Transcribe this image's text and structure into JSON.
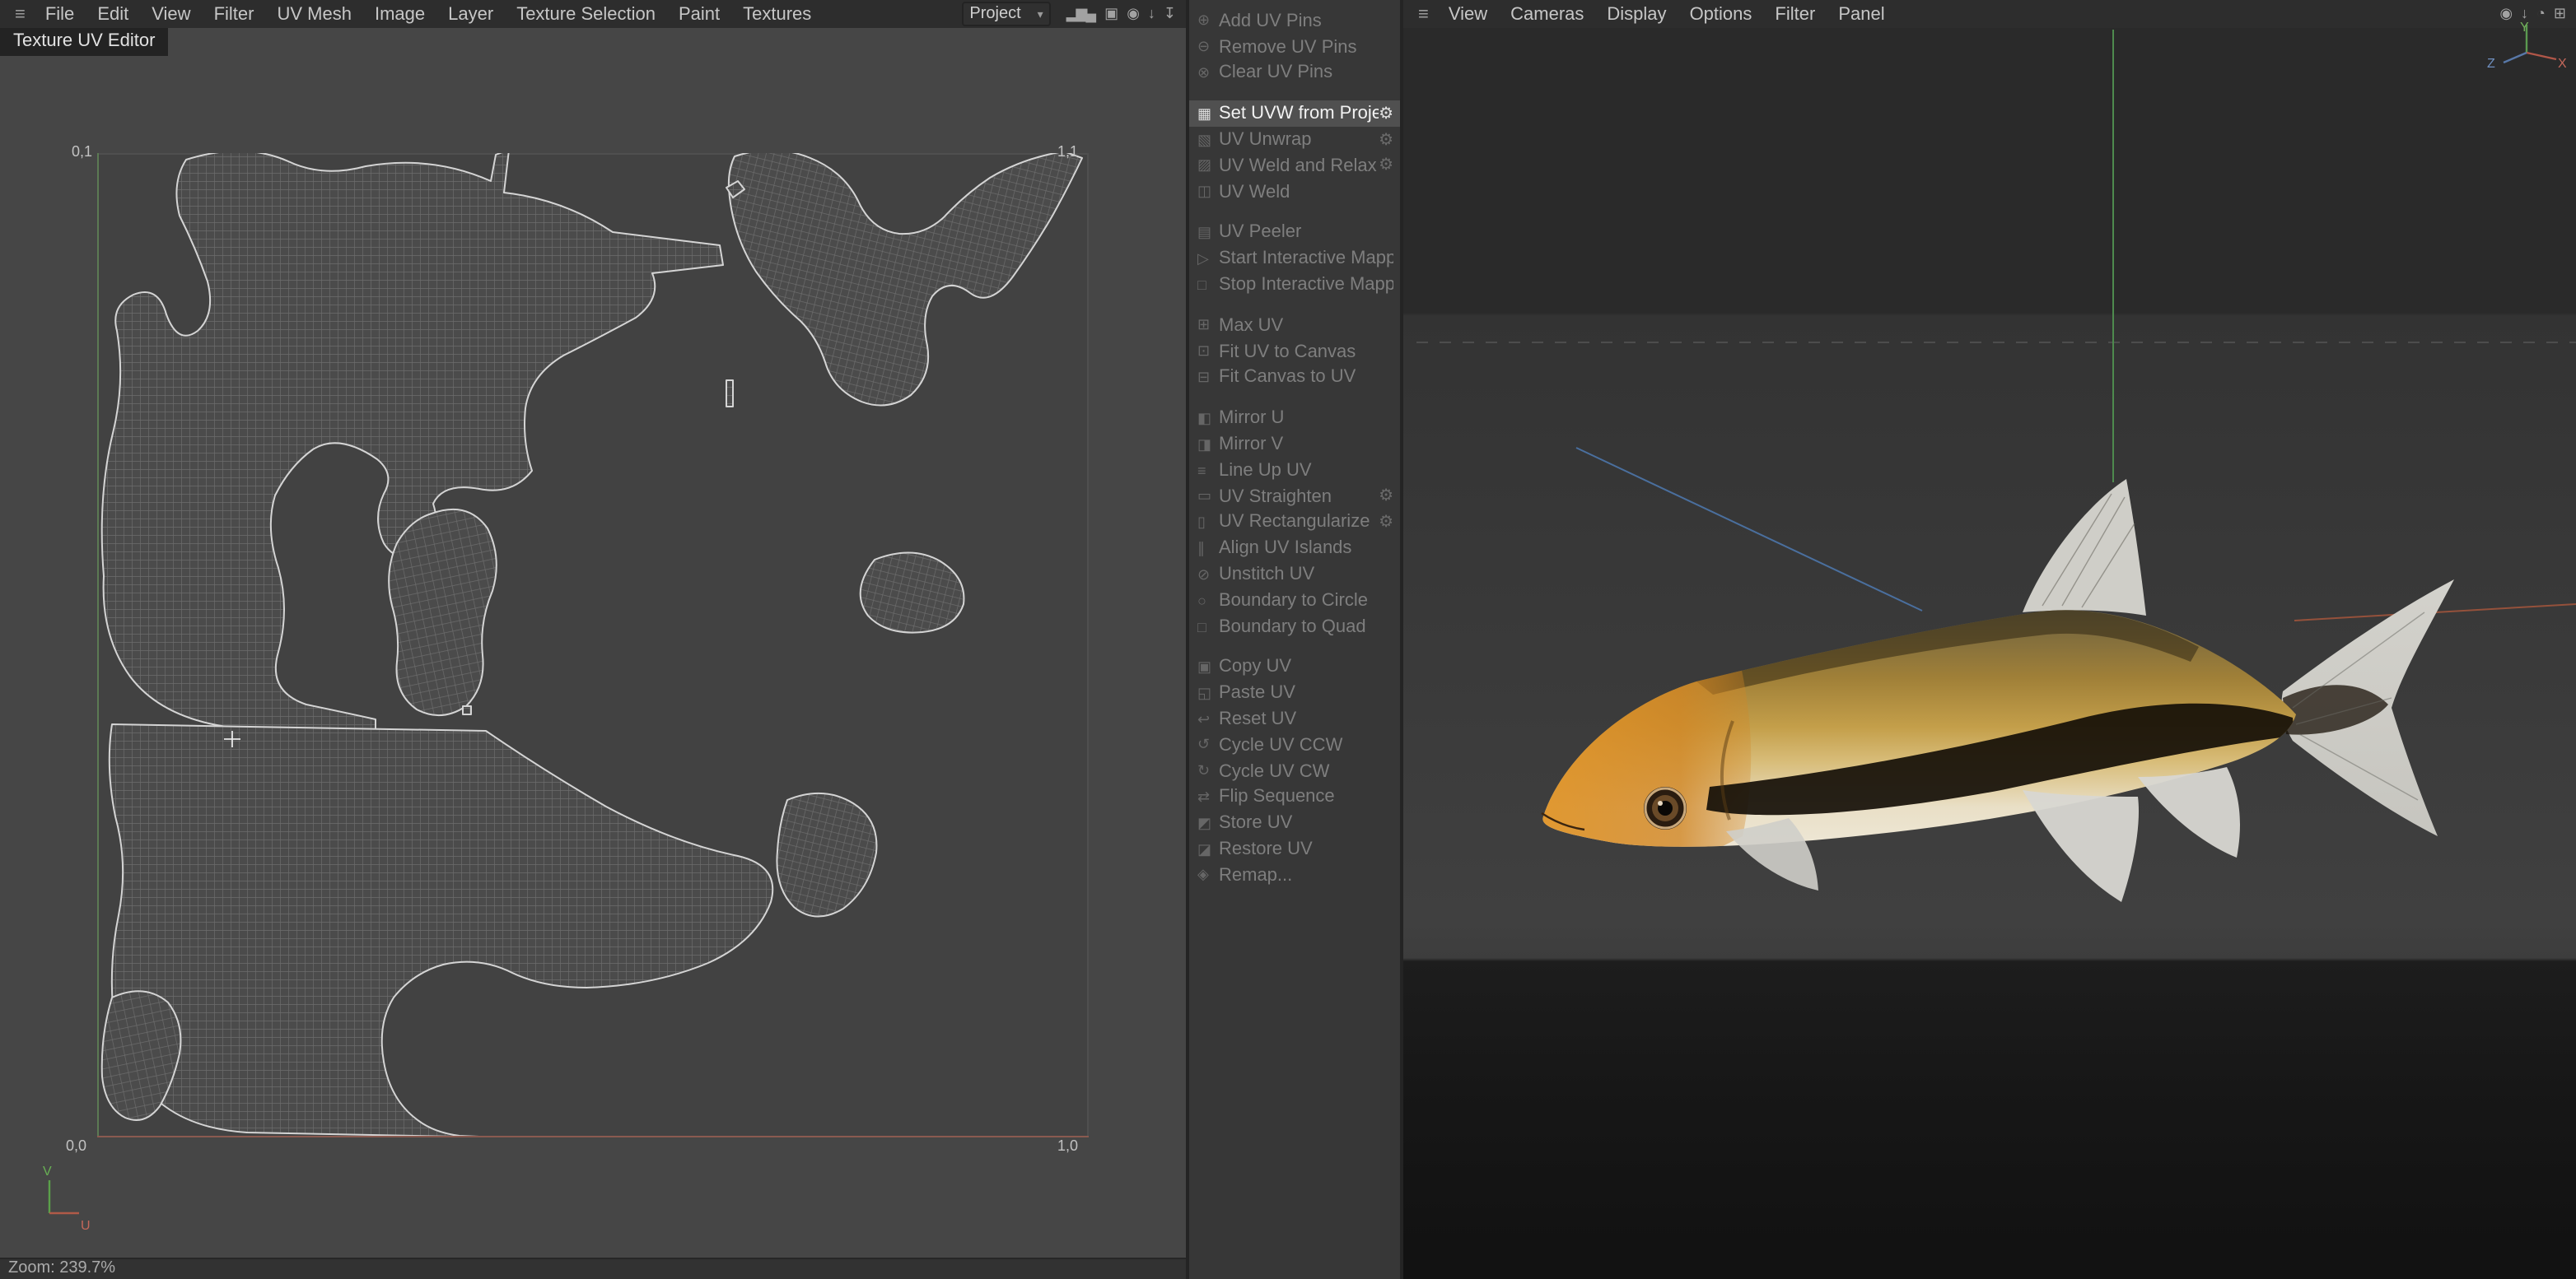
{
  "uv_pane": {
    "menubar": {
      "hamburger_glyph": "≡",
      "items": [
        "File",
        "Edit",
        "View",
        "Filter",
        "UV Mesh",
        "Image",
        "Layer",
        "Texture Selection",
        "Paint",
        "Textures"
      ],
      "project_label": "Project",
      "project_arrow": "▾",
      "right_icons": [
        {
          "name": "histogram-icon",
          "glyph": "▂▆▄"
        },
        {
          "name": "layers-icon",
          "glyph": "▣"
        },
        {
          "name": "sphere-icon",
          "glyph": "◉"
        },
        {
          "name": "import-arrow-icon",
          "glyph": "↓"
        },
        {
          "name": "export-arrow-icon",
          "glyph": "↧"
        }
      ]
    },
    "tab_label": "Texture UV Editor",
    "canvas": {
      "corner_top_left": "0,1",
      "corner_top_right": "1,1",
      "corner_bottom_left": "0,0",
      "corner_bottom_right": "1,0",
      "axis_v": "V",
      "axis_u": "U"
    },
    "status_zoom": "Zoom: 239.7%"
  },
  "commands": {
    "gear_glyph": "⚙",
    "groups": [
      {
        "items": [
          {
            "label": "Add UV Pins",
            "icon": "add-pin-icon",
            "glyph": "⊕",
            "state": "disabled",
            "gear": false
          },
          {
            "label": "Remove UV Pins",
            "icon": "remove-pin-icon",
            "glyph": "⊖",
            "state": "disabled",
            "gear": false
          },
          {
            "label": "Clear UV Pins",
            "icon": "clear-pins-icon",
            "glyph": "⊗",
            "state": "disabled",
            "gear": false
          }
        ]
      },
      {
        "items": [
          {
            "label": "Set UVW from Projection",
            "icon": "projection-icon",
            "glyph": "▦",
            "state": "highlighted",
            "gear": true
          },
          {
            "label": "UV Unwrap",
            "icon": "unwrap-icon",
            "glyph": "▧",
            "state": "disabled",
            "gear": true
          },
          {
            "label": "UV Weld and Relax",
            "icon": "weld-relax-icon",
            "glyph": "▨",
            "state": "disabled",
            "gear": true
          },
          {
            "label": "UV Weld",
            "icon": "weld-icon",
            "glyph": "◫",
            "state": "disabled",
            "gear": false
          }
        ]
      },
      {
        "items": [
          {
            "label": "UV Peeler",
            "icon": "peeler-icon",
            "glyph": "▤",
            "state": "disabled",
            "gear": false
          },
          {
            "label": "Start Interactive Mapping",
            "icon": "start-mapping-icon",
            "glyph": "▷",
            "state": "disabled",
            "gear": false
          },
          {
            "label": "Stop Interactive Mapping",
            "icon": "stop-mapping-icon",
            "glyph": "□",
            "state": "disabled",
            "gear": false
          }
        ]
      },
      {
        "items": [
          {
            "label": "Max UV",
            "icon": "max-uv-icon",
            "glyph": "⊞",
            "state": "disabled",
            "gear": false
          },
          {
            "label": "Fit UV to Canvas",
            "icon": "fit-uv-to-canvas-icon",
            "glyph": "⊡",
            "state": "disabled",
            "gear": false
          },
          {
            "label": "Fit Canvas to UV",
            "icon": "fit-canvas-to-uv-icon",
            "glyph": "⊟",
            "state": "disabled",
            "gear": false
          }
        ]
      },
      {
        "items": [
          {
            "label": "Mirror U",
            "icon": "mirror-u-icon",
            "glyph": "◧",
            "state": "disabled",
            "gear": false
          },
          {
            "label": "Mirror V",
            "icon": "mirror-v-icon",
            "glyph": "◨",
            "state": "disabled",
            "gear": false
          },
          {
            "label": "Line Up UV",
            "icon": "line-up-uv-icon",
            "glyph": "≡",
            "state": "disabled",
            "gear": false
          },
          {
            "label": "UV Straighten",
            "icon": "straighten-icon",
            "glyph": "▭",
            "state": "disabled",
            "gear": true
          },
          {
            "label": "UV Rectangularize",
            "icon": "rectangularize-icon",
            "glyph": "▯",
            "state": "disabled",
            "gear": true
          },
          {
            "label": "Align UV Islands",
            "icon": "align-islands-icon",
            "glyph": "∥",
            "state": "disabled",
            "gear": false
          },
          {
            "label": "Unstitch UV",
            "icon": "unstitch-icon",
            "glyph": "⊘",
            "state": "disabled",
            "gear": false
          },
          {
            "label": "Boundary to Circle",
            "icon": "boundary-circle-icon",
            "glyph": "○",
            "state": "disabled",
            "gear": false
          },
          {
            "label": "Boundary to Quad",
            "icon": "boundary-quad-icon",
            "glyph": "□",
            "state": "disabled",
            "gear": false
          }
        ]
      },
      {
        "items": [
          {
            "label": "Copy UV",
            "icon": "copy-uv-icon",
            "glyph": "▣",
            "state": "disabled",
            "gear": false
          },
          {
            "label": "Paste UV",
            "icon": "paste-uv-icon",
            "glyph": "◱",
            "state": "disabled",
            "gear": false
          },
          {
            "label": "Reset UV",
            "icon": "reset-uv-icon",
            "glyph": "↩",
            "state": "disabled",
            "gear": false
          },
          {
            "label": "Cycle UV CCW",
            "icon": "cycle-ccw-icon",
            "glyph": "↺",
            "state": "disabled",
            "gear": false
          },
          {
            "label": "Cycle UV CW",
            "icon": "cycle-cw-icon",
            "glyph": "↻",
            "state": "disabled",
            "gear": false
          },
          {
            "label": "Flip Sequence",
            "icon": "flip-sequence-icon",
            "glyph": "⇄",
            "state": "disabled",
            "gear": false
          },
          {
            "label": "Store UV",
            "icon": "store-uv-icon",
            "glyph": "◩",
            "state": "disabled",
            "gear": false
          },
          {
            "label": "Restore UV",
            "icon": "restore-uv-icon",
            "glyph": "◪",
            "state": "disabled",
            "gear": false
          },
          {
            "label": "Remap...",
            "icon": "remap-icon",
            "glyph": "◈",
            "state": "disabled",
            "gear": false
          }
        ]
      }
    ]
  },
  "viewport": {
    "menubar": {
      "hamburger_glyph": "≡",
      "items": [
        "View",
        "Cameras",
        "Display",
        "Options",
        "Filter",
        "Panel"
      ],
      "right_icons": [
        {
          "name": "sphere-icon",
          "glyph": "◉"
        },
        {
          "name": "download-icon",
          "glyph": "↓"
        },
        {
          "name": "history-icon",
          "glyph": "◔"
        },
        {
          "name": "grid-icon",
          "glyph": "⊞"
        }
      ]
    },
    "gizmo": {
      "x": "X",
      "y": "Y",
      "z": "Z"
    }
  },
  "colors": {
    "axis_x": "#c4685a",
    "axis_y": "#72b05c",
    "axis_z": "#7090c0",
    "uv_axis_u": "#b05a48",
    "uv_axis_v": "#5aa04a",
    "highlight_row": "#505050",
    "fish_gold": "#c49f4a",
    "fish_orange": "#d78f2a"
  }
}
